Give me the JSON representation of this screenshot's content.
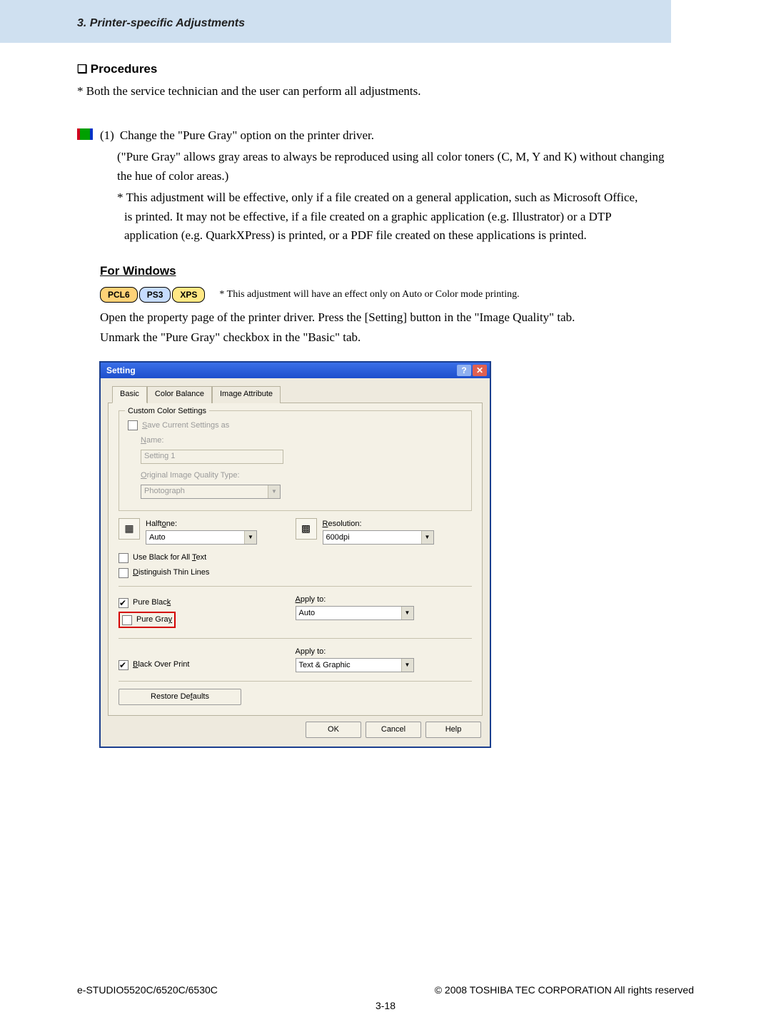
{
  "header": {
    "breadcrumb": "3. Printer-specific Adjustments"
  },
  "procedures": {
    "heading": "Procedures",
    "note": "* Both the service technician and the user can perform all adjustments."
  },
  "step1": {
    "num": "(1)",
    "line1": "Change the \"Pure Gray\" option on the printer driver.",
    "line2": "(\"Pure Gray\" allows gray areas to always be reproduced using all color toners (C, M, Y and K) without changing the hue of color areas.)",
    "line3a": "* This adjustment will be effective, only if a file created on a general application, such as Microsoft Office,",
    "line3b": "is printed.  It may not be effective, if a file created on a graphic application (e.g. Illustrator) or a DTP",
    "line3c": "application (e.g. QuarkXPress) is printed, or a PDF file created on these applications is printed."
  },
  "for_windows": {
    "heading": "For Windows",
    "badges": {
      "pcl6": "PCL6",
      "ps3": "PS3",
      "xps": "XPS"
    },
    "badge_note": "* This adjustment will have an effect only on Auto or Color mode printing.",
    "instr1": "Open the property page of the printer driver.  Press the [Setting] button in the \"Image Quality\" tab.",
    "instr2": "Unmark the \"Pure Gray\" checkbox in the \"Basic\" tab."
  },
  "dialog": {
    "title": "Setting",
    "tabs": {
      "basic": "Basic",
      "color_balance": "Color Balance",
      "image_attribute": "Image Attribute"
    },
    "custom_color_settings": {
      "legend": "Custom Color Settings",
      "save_current": "Save Current Settings as",
      "name_label": "Name:",
      "name_value": "Setting 1",
      "oiqt_label": "Original Image Quality Type:",
      "oiqt_value": "Photograph"
    },
    "halftone": {
      "label": "Halftone:",
      "value": "Auto"
    },
    "resolution": {
      "label": "Resolution:",
      "value": "600dpi"
    },
    "use_black_all_text": "Use Black for All Text",
    "distinguish_thin_lines": "Distinguish Thin Lines",
    "pure_black": "Pure Black",
    "pure_gray": "Pure Gray",
    "apply_to_label": "Apply to:",
    "apply_to_1_value": "Auto",
    "black_over_print": "Black Over Print",
    "apply_to_2_value": "Text & Graphic",
    "restore_defaults": "Restore Defaults",
    "ok": "OK",
    "cancel": "Cancel",
    "help": "Help"
  },
  "footer": {
    "left": "e-STUDIO5520C/6520C/6530C",
    "right": "© 2008 TOSHIBA TEC CORPORATION All rights reserved",
    "page": "3-18"
  }
}
